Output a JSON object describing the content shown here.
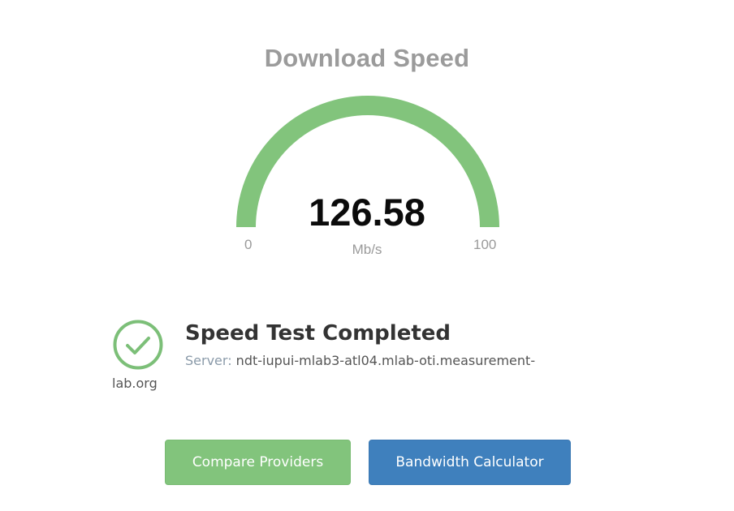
{
  "heading": "Download Speed",
  "gauge": {
    "value": "126.58",
    "unit": "Mb/s",
    "min_label": "0",
    "max_label": "100",
    "fill_fraction": 1.0,
    "arc_color": "#82c47c"
  },
  "status": {
    "icon": "check-circle-icon",
    "icon_color": "#7cbf78",
    "title": "Speed Test Completed",
    "server_label": "Server:",
    "server_line1": "ndt-iupui-mlab3-atl04.mlab-oti.measurement-",
    "server_line2": "lab.org"
  },
  "buttons": {
    "compare_label": "Compare Providers",
    "compare_color": "#82c47c",
    "bandwidth_label": "Bandwidth Calculator",
    "bandwidth_color": "#3f80bd"
  }
}
